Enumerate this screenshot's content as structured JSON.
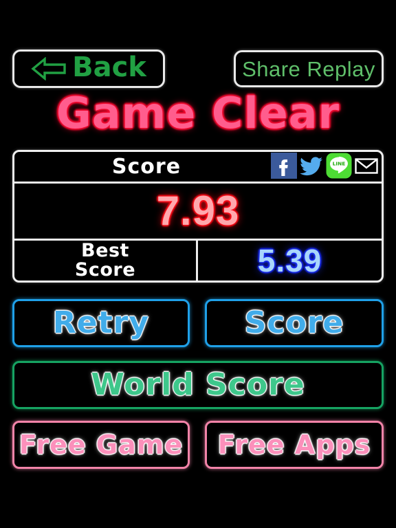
{
  "app": {
    "background_color": "#000000"
  },
  "header": {
    "back_button": {
      "label": "Back",
      "icon": "arrow-left-icon",
      "color": "#21a043"
    },
    "share_button": {
      "label": "Share Replay",
      "color": "#5fbf6a"
    }
  },
  "title": {
    "text": "Game Clear",
    "color": "#ff5d8d",
    "glow_color": "#f50c33"
  },
  "score_panel": {
    "score_label": "Score",
    "score_value": "7.93",
    "score_color": "#ffa8ad",
    "score_glow": "#ff0d18",
    "best_label": "Best\nScore",
    "best_label_line1": "Best",
    "best_label_line2": "Score",
    "best_value": "5.39",
    "best_color": "#a9d6fb",
    "best_glow": "#1a2df2",
    "share_icons": [
      {
        "name": "facebook-icon",
        "label": "f",
        "color": "#3b5a9b"
      },
      {
        "name": "twitter-icon",
        "label": "Twitter",
        "color": "#55acee"
      },
      {
        "name": "line-icon",
        "label": "LINE",
        "color": "#4ddc34"
      },
      {
        "name": "mail-icon",
        "label": "Mail",
        "color": "#ffffff"
      }
    ]
  },
  "menu": {
    "retry": {
      "label": "Retry",
      "color": "#41acea",
      "border": "#1fa0e8"
    },
    "score": {
      "label": "Score",
      "color": "#41acea",
      "border": "#1fa0e8"
    },
    "world_score": {
      "label": "World Score",
      "color": "#3ec78b",
      "border": "#16a362"
    },
    "free_game": {
      "label": "Free Game",
      "color": "#fb90bb",
      "border": "#f283a8"
    },
    "free_apps": {
      "label": "Free Apps",
      "color": "#fb90bb",
      "border": "#f283a8"
    }
  }
}
